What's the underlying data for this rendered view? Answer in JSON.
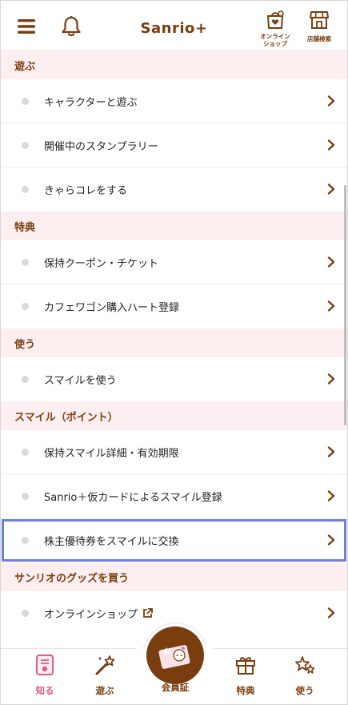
{
  "header": {
    "logo": "Sanrio+",
    "shop_label_1": "オンライン",
    "shop_label_2": "ショップ",
    "store_label": "店舗検索"
  },
  "sections": [
    {
      "title": "遊ぶ",
      "items": [
        "キャラクターと遊ぶ",
        "開催中のスタンプラリー",
        "きゃらコレをする"
      ]
    },
    {
      "title": "特典",
      "items": [
        "保持クーポン・チケット",
        "カフェワゴン購入ハート登録"
      ]
    },
    {
      "title": "使う",
      "items": [
        "スマイルを使う"
      ]
    },
    {
      "title": "スマイル（ポイント）",
      "items": [
        "保持スマイル詳細・有効期限",
        "Sanrio＋仮カードによるスマイル登録",
        "株主優待券をスマイルに交換"
      ]
    },
    {
      "title": "サンリオのグッズを買う",
      "items": [
        "オンラインショップ"
      ]
    }
  ],
  "nav": {
    "know": "知る",
    "play": "遊ぶ",
    "card": "会員証",
    "perks": "特典",
    "use": "使う"
  },
  "colors": {
    "brand_brown": "#7a3d0f",
    "section_bg": "#fdeef0",
    "active_pink": "#e05a86",
    "highlight_blue": "#6b82d8"
  }
}
